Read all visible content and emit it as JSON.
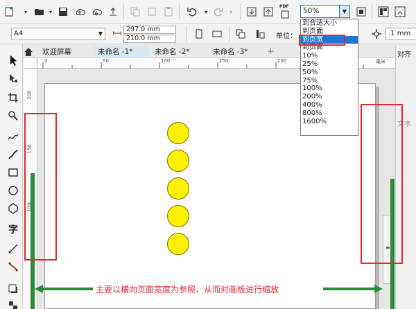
{
  "toolbar": {
    "icons": [
      "new-document-icon",
      "open-folder-icon",
      "save-icon",
      "import-icon",
      "export-icon",
      "publish-icon",
      "cut-icon",
      "copy-icon",
      "paste-icon",
      "undo-icon",
      "redo-icon",
      "import-file-icon",
      "export-file-icon",
      "publish-pdf-icon",
      "full-screen-icon",
      "view-icon",
      "grid-icon"
    ],
    "pdf_label": "PDF",
    "zoom_value": "50%"
  },
  "zoom_dropdown": {
    "options": [
      "到合适大小",
      "到页面",
      "到页宽",
      "到页高",
      "10%",
      "25%",
      "50%",
      "75%",
      "100%",
      "200%",
      "400%",
      "800%",
      "1600%"
    ],
    "selected_index": 2
  },
  "property_bar": {
    "paper_size": "A4",
    "width": "297.0 mm",
    "height": "210.0 mm",
    "units_label": "单位：",
    "nudge": ".1 mm"
  },
  "tabs": [
    {
      "label": "欢迎屏幕",
      "active": false
    },
    {
      "label": "未命名 -1*",
      "active": true
    },
    {
      "label": "未命名 -2*",
      "active": false
    },
    {
      "label": "未命名 -3*",
      "active": false
    }
  ],
  "add_tab_label": "+",
  "docker": {
    "title": "对齐",
    "label2": "文本"
  },
  "ruler": {
    "h_labels": [
      "0",
      "50",
      "100",
      "150",
      "200",
      "250"
    ],
    "v_labels": [
      "200",
      "150",
      "100"
    ],
    "unit": "毫米"
  },
  "annotation": {
    "note": "主要以横向页面宽度为参照，从而对画板进行缩放"
  },
  "colors": {
    "accent": "#1e77d3",
    "annotation_red": "#e8262b",
    "annotation_green": "#2c8a3a",
    "circle_fill": "#ffef00"
  },
  "canvas": {
    "circle_count": 5
  }
}
